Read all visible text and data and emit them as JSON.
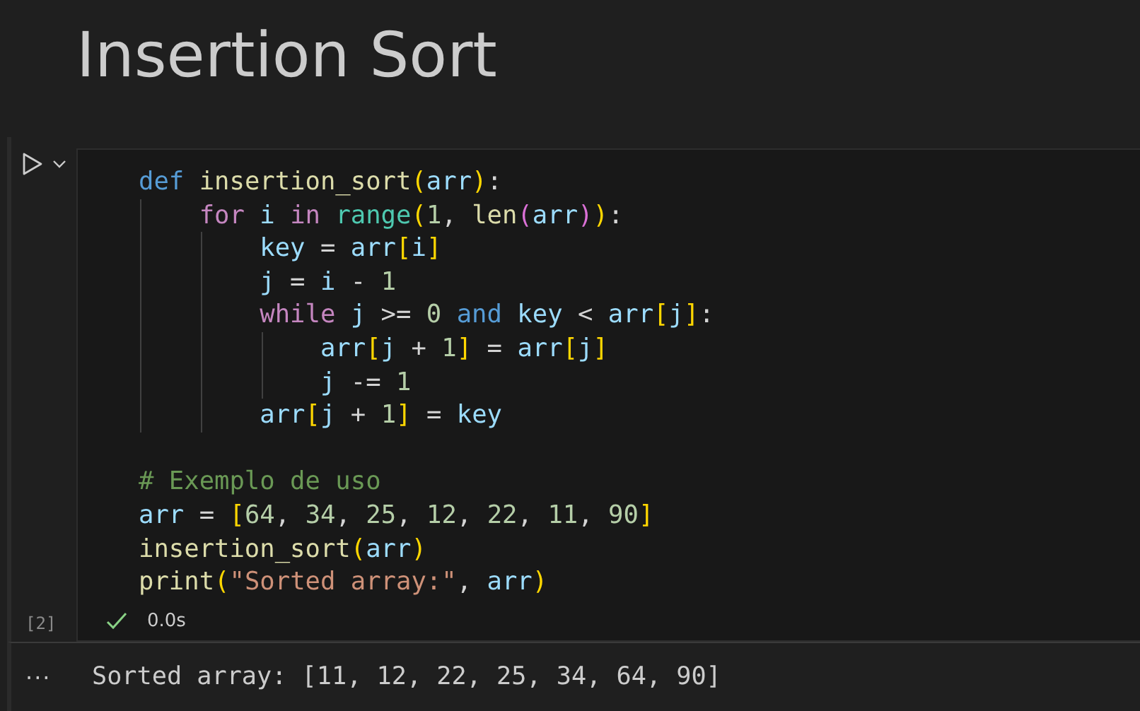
{
  "title": "Insertion Sort",
  "cell": {
    "execution_count": "[2]",
    "status": {
      "succeeded": true,
      "duration": "0.0s"
    },
    "lines": [
      {
        "kind": "code",
        "tokens": [
          {
            "kind": "keyword",
            "text": "def "
          },
          {
            "kind": "function",
            "text": "insertion_sort"
          },
          {
            "kind": "bracket1",
            "text": "("
          },
          {
            "kind": "variable",
            "text": "arr"
          },
          {
            "kind": "bracket1",
            "text": ")"
          },
          {
            "kind": "plain",
            "text": ":"
          }
        ],
        "children": [
          {
            "kind": "code",
            "tokens": [
              {
                "kind": "control",
                "text": "for "
              },
              {
                "kind": "variable",
                "text": "i "
              },
              {
                "kind": "control",
                "text": "in "
              },
              {
                "kind": "type",
                "text": "range"
              },
              {
                "kind": "bracket1",
                "text": "("
              },
              {
                "kind": "number",
                "text": "1"
              },
              {
                "kind": "plain",
                "text": ", "
              },
              {
                "kind": "function",
                "text": "len"
              },
              {
                "kind": "bracket2",
                "text": "("
              },
              {
                "kind": "variable",
                "text": "arr"
              },
              {
                "kind": "bracket2",
                "text": ")"
              },
              {
                "kind": "bracket1",
                "text": ")"
              },
              {
                "kind": "plain",
                "text": ":"
              }
            ],
            "children": [
              {
                "kind": "code",
                "tokens": [
                  {
                    "kind": "variable",
                    "text": "key "
                  },
                  {
                    "kind": "plain",
                    "text": "= "
                  },
                  {
                    "kind": "variable",
                    "text": "arr"
                  },
                  {
                    "kind": "bracket1",
                    "text": "["
                  },
                  {
                    "kind": "variable",
                    "text": "i"
                  },
                  {
                    "kind": "bracket1",
                    "text": "]"
                  }
                ]
              },
              {
                "kind": "code",
                "tokens": [
                  {
                    "kind": "variable",
                    "text": "j "
                  },
                  {
                    "kind": "plain",
                    "text": "= "
                  },
                  {
                    "kind": "variable",
                    "text": "i "
                  },
                  {
                    "kind": "plain",
                    "text": "- "
                  },
                  {
                    "kind": "number",
                    "text": "1"
                  }
                ]
              },
              {
                "kind": "code",
                "tokens": [
                  {
                    "kind": "control",
                    "text": "while "
                  },
                  {
                    "kind": "variable",
                    "text": "j "
                  },
                  {
                    "kind": "plain",
                    "text": ">= "
                  },
                  {
                    "kind": "number",
                    "text": "0 "
                  },
                  {
                    "kind": "keyword",
                    "text": "and "
                  },
                  {
                    "kind": "variable",
                    "text": "key "
                  },
                  {
                    "kind": "plain",
                    "text": "< "
                  },
                  {
                    "kind": "variable",
                    "text": "arr"
                  },
                  {
                    "kind": "bracket1",
                    "text": "["
                  },
                  {
                    "kind": "variable",
                    "text": "j"
                  },
                  {
                    "kind": "bracket1",
                    "text": "]"
                  },
                  {
                    "kind": "plain",
                    "text": ":"
                  }
                ],
                "children": [
                  {
                    "kind": "code",
                    "tokens": [
                      {
                        "kind": "variable",
                        "text": "arr"
                      },
                      {
                        "kind": "bracket1",
                        "text": "["
                      },
                      {
                        "kind": "variable",
                        "text": "j "
                      },
                      {
                        "kind": "plain",
                        "text": "+ "
                      },
                      {
                        "kind": "number",
                        "text": "1"
                      },
                      {
                        "kind": "bracket1",
                        "text": "]"
                      },
                      {
                        "kind": "plain",
                        "text": " = "
                      },
                      {
                        "kind": "variable",
                        "text": "arr"
                      },
                      {
                        "kind": "bracket1",
                        "text": "["
                      },
                      {
                        "kind": "variable",
                        "text": "j"
                      },
                      {
                        "kind": "bracket1",
                        "text": "]"
                      }
                    ]
                  },
                  {
                    "kind": "code",
                    "tokens": [
                      {
                        "kind": "variable",
                        "text": "j "
                      },
                      {
                        "kind": "plain",
                        "text": "-= "
                      },
                      {
                        "kind": "number",
                        "text": "1"
                      }
                    ]
                  }
                ]
              },
              {
                "kind": "code",
                "tokens": [
                  {
                    "kind": "variable",
                    "text": "arr"
                  },
                  {
                    "kind": "bracket1",
                    "text": "["
                  },
                  {
                    "kind": "variable",
                    "text": "j "
                  },
                  {
                    "kind": "plain",
                    "text": "+ "
                  },
                  {
                    "kind": "number",
                    "text": "1"
                  },
                  {
                    "kind": "bracket1",
                    "text": "]"
                  },
                  {
                    "kind": "plain",
                    "text": " = "
                  },
                  {
                    "kind": "variable",
                    "text": "key"
                  }
                ]
              }
            ]
          }
        ]
      },
      {
        "kind": "blank"
      },
      {
        "kind": "code",
        "tokens": [
          {
            "kind": "comment",
            "text": "# Exemplo de uso"
          }
        ]
      },
      {
        "kind": "code",
        "tokens": [
          {
            "kind": "variable",
            "text": "arr "
          },
          {
            "kind": "plain",
            "text": "= "
          },
          {
            "kind": "bracket1",
            "text": "["
          },
          {
            "kind": "number",
            "text": "64"
          },
          {
            "kind": "plain",
            "text": ", "
          },
          {
            "kind": "number",
            "text": "34"
          },
          {
            "kind": "plain",
            "text": ", "
          },
          {
            "kind": "number",
            "text": "25"
          },
          {
            "kind": "plain",
            "text": ", "
          },
          {
            "kind": "number",
            "text": "12"
          },
          {
            "kind": "plain",
            "text": ", "
          },
          {
            "kind": "number",
            "text": "22"
          },
          {
            "kind": "plain",
            "text": ", "
          },
          {
            "kind": "number",
            "text": "11"
          },
          {
            "kind": "plain",
            "text": ", "
          },
          {
            "kind": "number",
            "text": "90"
          },
          {
            "kind": "bracket1",
            "text": "]"
          }
        ]
      },
      {
        "kind": "code",
        "tokens": [
          {
            "kind": "function",
            "text": "insertion_sort"
          },
          {
            "kind": "bracket1",
            "text": "("
          },
          {
            "kind": "variable",
            "text": "arr"
          },
          {
            "kind": "bracket1",
            "text": ")"
          }
        ]
      },
      {
        "kind": "code",
        "tokens": [
          {
            "kind": "function",
            "text": "print"
          },
          {
            "kind": "bracket1",
            "text": "("
          },
          {
            "kind": "string",
            "text": "\"Sorted array:\""
          },
          {
            "kind": "plain",
            "text": ", "
          },
          {
            "kind": "variable",
            "text": "arr"
          },
          {
            "kind": "bracket1",
            "text": ")"
          }
        ]
      }
    ]
  },
  "output": {
    "menu": "···",
    "text": "Sorted array: [11, 12, 22, 25, 34, 64, 90]"
  }
}
